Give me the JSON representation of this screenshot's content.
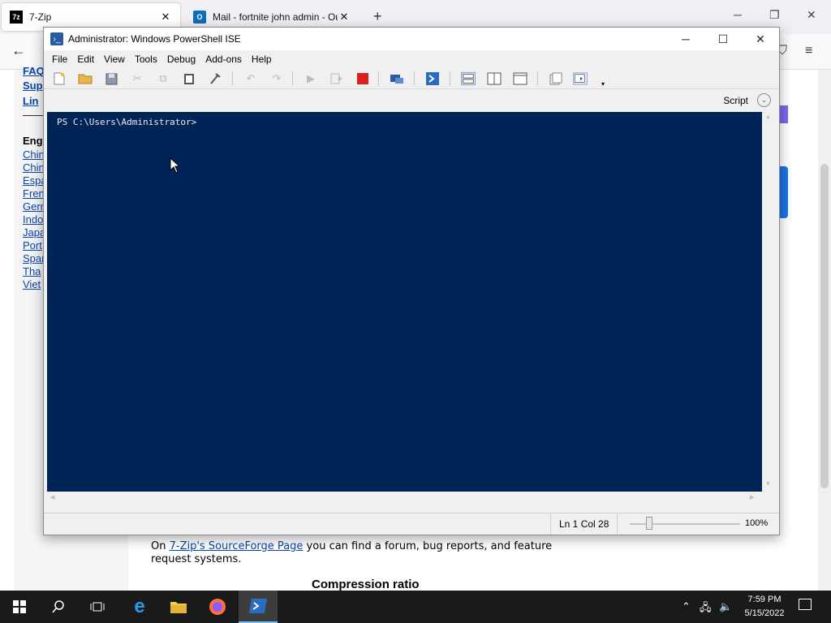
{
  "browser": {
    "tabs": [
      {
        "label": "7-Zip",
        "favicon": "7z"
      },
      {
        "label": "Mail - fortnite john admin - Ou",
        "favicon": "O"
      }
    ],
    "new_tab": "+",
    "controls": {
      "minimize": "─",
      "restore": "❐",
      "close": "✕"
    },
    "back": "←",
    "page": {
      "sidebar_links": [
        "FAQ",
        "Sup",
        "Lin"
      ],
      "heading": "Eng",
      "languages": [
        "Chin",
        "Chin",
        "Espa",
        "Fren",
        "Gern",
        "Indo",
        "Japa",
        "Port",
        "Span",
        "Tha",
        "Viet"
      ],
      "para_prefix": "On ",
      "para_link": "7-Zip's SourceForge Page",
      "para_suffix": " you can find a forum, bug reports, and feature request systems.",
      "section_heading": "Compression ratio"
    }
  },
  "ise": {
    "title": "Administrator: Windows PowerShell ISE",
    "window_controls": {
      "minimize": "─",
      "maximize": "☐",
      "close": "✕"
    },
    "menu": [
      "File",
      "Edit",
      "View",
      "Tools",
      "Debug",
      "Add-ons",
      "Help"
    ],
    "toolbar": {
      "new": "new-script-icon",
      "open": "open-folder-icon",
      "save": "save-icon",
      "cut": "cut-icon",
      "copy": "copy-icon",
      "paste": "paste-icon",
      "clear": "clear-console-icon",
      "undo": "undo-icon",
      "redo": "redo-icon",
      "run": "run-icon",
      "run_selection": "run-selection-icon",
      "stop": "stop-icon",
      "remote": "new-remote-tab-icon",
      "start_powershell": "start-powershell-icon",
      "layout_top": "script-pane-top-icon",
      "layout_right": "script-pane-right-icon",
      "layout_max": "script-pane-max-icon",
      "show_commands": "show-command-window-icon",
      "show_addon": "show-command-addon-icon"
    },
    "script_label": "Script",
    "console_text": "PS C:\\Users\\Administrator>",
    "status": {
      "position": "Ln 1  Col 28",
      "zoom": "100%"
    },
    "zoom_level_percent": 100
  },
  "taskbar": {
    "items": [
      "start-icon",
      "search-icon",
      "task-view-icon",
      "internet-explorer-icon",
      "file-explorer-icon",
      "firefox-icon",
      "powershell-ise-icon"
    ],
    "time": "7:59 PM",
    "date": "5/15/2022"
  },
  "colors": {
    "console_bg": "#012456",
    "console_fg": "#eeedf0",
    "stop_red": "#d9201c",
    "taskbar_bg": "#1a1a1a"
  }
}
